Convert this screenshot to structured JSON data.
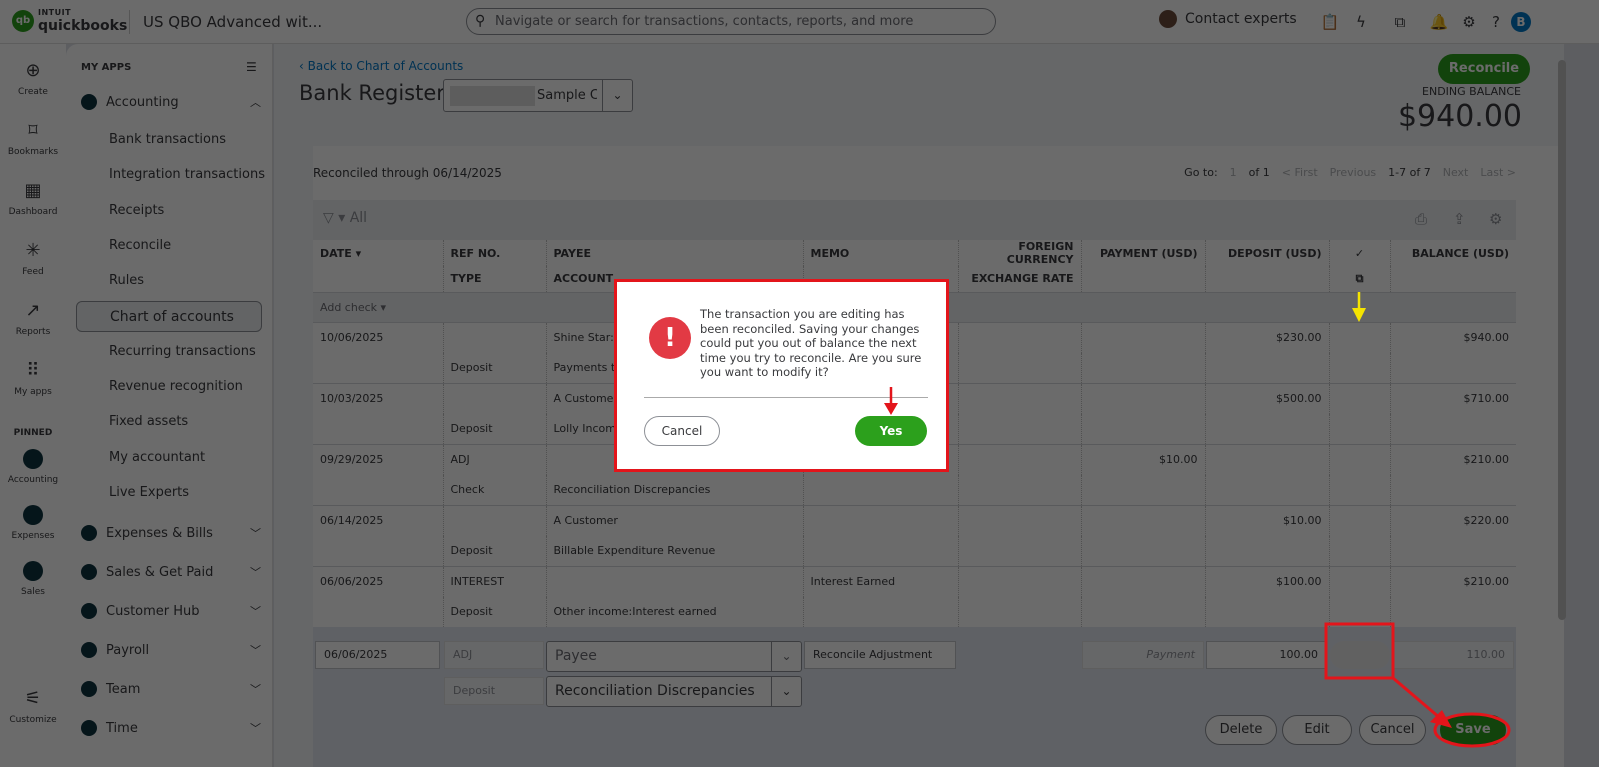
{
  "topbar": {
    "logo_top": "INTUIT",
    "logo_bottom": "quickbooks",
    "company": "US QBO Advanced wit...",
    "search_placeholder": "Navigate or search for transactions, contacts, reports, and more",
    "contact_experts": "Contact experts",
    "user_initial": "B"
  },
  "rail": [
    {
      "label": "Create",
      "icon": "⊕"
    },
    {
      "label": "Bookmarks",
      "icon": "⌑"
    },
    {
      "label": "Dashboard",
      "icon": "▦"
    },
    {
      "label": "Feed",
      "icon": "✳"
    },
    {
      "label": "Reports",
      "icon": "↗"
    },
    {
      "label": "My apps",
      "icon": "⠿"
    }
  ],
  "rail_pinned_label": "PINNED",
  "rail_pinned": [
    {
      "label": "Accounting"
    },
    {
      "label": "Expenses"
    },
    {
      "label": "Sales"
    }
  ],
  "rail_customize": "Customize",
  "apps": {
    "header": "MY APPS",
    "accounting": "Accounting",
    "accounting_items": [
      "Bank transactions",
      "Integration transactions",
      "Receipts",
      "Reconcile",
      "Rules",
      "Chart of accounts",
      "Recurring transactions",
      "Revenue recognition",
      "Fixed assets",
      "My accountant",
      "Live Experts"
    ],
    "groups": [
      "Expenses & Bills",
      "Sales & Get Paid",
      "Customer Hub",
      "Payroll",
      "Team",
      "Time"
    ]
  },
  "main": {
    "back": "Back to Chart of Accounts",
    "title": "Bank Register",
    "account": "Sample C",
    "reconcile": "Reconcile",
    "ending_label": "ENDING BALANCE",
    "ending_value": "$940.00",
    "reconciled_through": "Reconciled through 06/14/2025",
    "pager": {
      "goto": "Go to:",
      "page": "1",
      "of": "of 1",
      "first": "< First",
      "previous": "Previous",
      "range": "1-7 of 7",
      "next": "Next",
      "last": "Last >"
    },
    "filter": "All"
  },
  "table": {
    "headers": {
      "date": "DATE ▾",
      "ref": "REF NO.",
      "type": "TYPE",
      "payee": "PAYEE",
      "account": "ACCOUNT",
      "memo": "MEMO",
      "fc": "FOREIGN CURRENCY",
      "rate": "EXCHANGE RATE",
      "payment": "PAYMENT (USD)",
      "deposit": "DEPOSIT (USD)",
      "check": "✓",
      "balance": "BALANCE (USD)"
    },
    "add_check": "Add check ▾",
    "rows": [
      {
        "date": "10/06/2025",
        "ref": "",
        "type": "Deposit",
        "payee": "Shine Star:S",
        "account": "Payments to",
        "memo": "",
        "payment": "",
        "deposit": "$230.00",
        "balance": "$940.00"
      },
      {
        "date": "10/03/2025",
        "ref": "",
        "type": "Deposit",
        "payee": "A Customer",
        "account": "Lolly Income",
        "memo": "",
        "payment": "",
        "deposit": "$500.00",
        "balance": "$710.00"
      },
      {
        "date": "09/29/2025",
        "ref": "ADJ",
        "type": "Check",
        "payee": "",
        "account": "Reconciliation Discrepancies",
        "memo": "",
        "payment": "$10.00",
        "deposit": "",
        "balance": "$210.00"
      },
      {
        "date": "06/14/2025",
        "ref": "",
        "type": "Deposit",
        "payee": "A Customer",
        "account": "Billable Expenditure Revenue",
        "memo": "",
        "payment": "",
        "deposit": "$10.00",
        "balance": "$220.00"
      },
      {
        "date": "06/06/2025",
        "ref": "INTEREST",
        "type": "Deposit",
        "payee": "",
        "account": "Other income:Interest earned",
        "memo": "Interest Earned",
        "payment": "",
        "deposit": "$100.00",
        "balance": "$210.00"
      }
    ]
  },
  "edit": {
    "date": "06/06/2025",
    "ref": "ADJ",
    "type": "Deposit",
    "payee_placeholder": "Payee",
    "account": "Reconciliation Discrepancies",
    "memo": "Reconcile Adjustment",
    "payment_placeholder": "Payment",
    "deposit": "100.00",
    "balance": "110.00",
    "delete": "Delete",
    "edit": "Edit",
    "cancel": "Cancel",
    "save": "Save"
  },
  "dialog": {
    "message": "The transaction you are editing has been reconciled. Saving your changes could put you out of balance the next time you try to reconcile. Are you sure you want to modify it?",
    "cancel": "Cancel",
    "yes": "Yes"
  },
  "colors": {
    "brand": "#2ca01c",
    "annotation": "#e3151b",
    "arrow_yellow": "#f5e400"
  }
}
